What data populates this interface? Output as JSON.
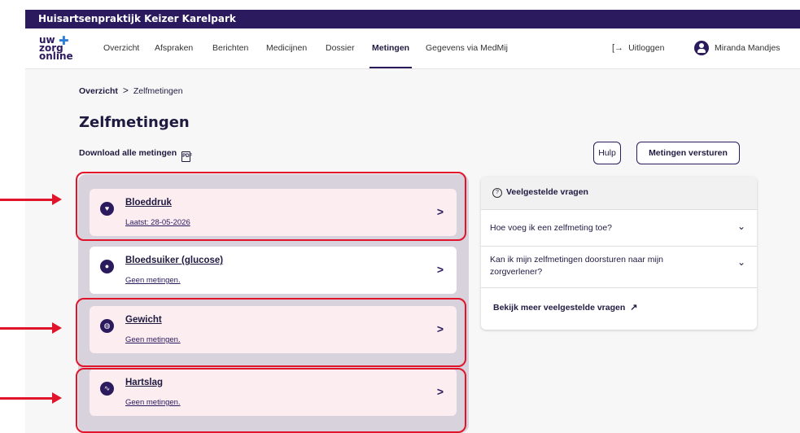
{
  "practice_name": "Huisartsenpraktijk Keizer Karelpark",
  "logo": {
    "line1": "uw",
    "line2": "zorg",
    "line3": "online",
    "plus": "✚"
  },
  "nav": {
    "items": [
      {
        "label": "Overzicht"
      },
      {
        "label": "Afspraken"
      },
      {
        "label": "Berichten"
      },
      {
        "label": "Medicijnen"
      },
      {
        "label": "Dossier"
      },
      {
        "label": "Metingen"
      },
      {
        "label": "Gegevens via MedMij"
      }
    ],
    "active": "Metingen",
    "logout_label": "Uitloggen",
    "logout_icon": "[→",
    "user_name": "Miranda Mandjes"
  },
  "breadcrumb": {
    "parent": "Overzicht",
    "separator": ">",
    "current": "Zelfmetingen"
  },
  "page_title": "Zelfmetingen",
  "download_label": "Download alle metingen",
  "buttons": {
    "help": "Hulp",
    "send": "Metingen versturen"
  },
  "measurements": [
    {
      "title": "Bloeddruk",
      "subtitle": "Laatst: 28-05-2026",
      "icon": "heart-icon",
      "glyph": "♥",
      "highlighted": true
    },
    {
      "title": "Bloedsuiker (glucose)",
      "subtitle": "Geen metingen.",
      "icon": "drop-icon",
      "glyph": "●",
      "highlighted": false
    },
    {
      "title": "Gewicht",
      "subtitle": "Geen metingen.",
      "icon": "scale-icon",
      "glyph": "◍",
      "highlighted": true
    },
    {
      "title": "Hartslag",
      "subtitle": "Geen metingen.",
      "icon": "pulse-icon",
      "glyph": "∿",
      "highlighted": true
    }
  ],
  "chevron": ">",
  "faq": {
    "heading": "Veelgestelde vragen",
    "questions": [
      "Hoe voeg ik een zelfmeting toe?",
      "Kan ik mijn zelfmetingen doorsturen naar mijn zorgverlener?"
    ],
    "expand_glyph": "⌄",
    "more_label": "Bekijk meer veelgestelde vragen",
    "more_icon": "↗"
  },
  "colors": {
    "brand": "#2b1a5e",
    "highlight": "#e0142a",
    "card_pink": "#fbedf0",
    "list_bg": "#d8d2dd"
  }
}
